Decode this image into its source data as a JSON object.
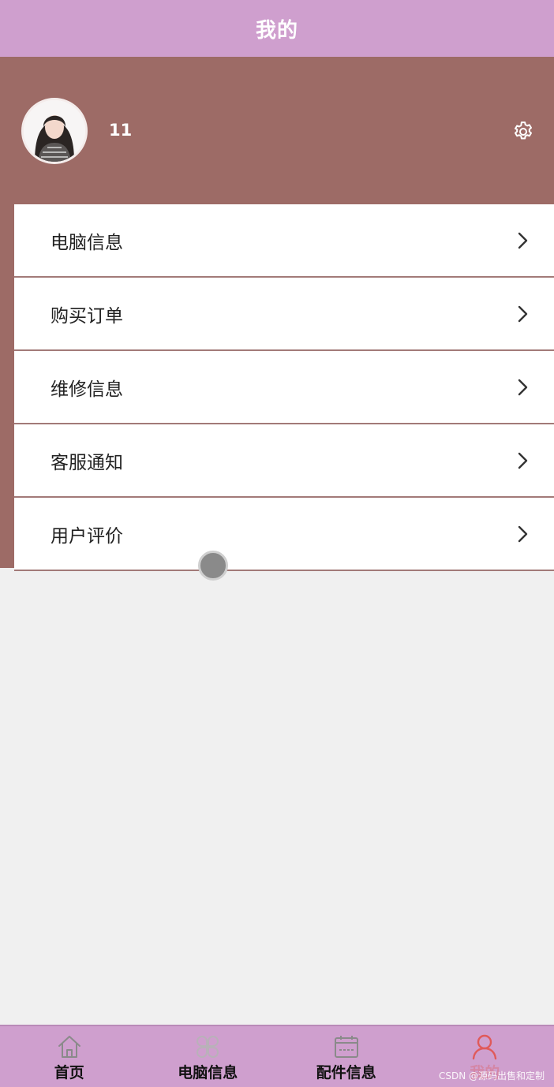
{
  "header": {
    "title": "我的"
  },
  "profile": {
    "username": "11",
    "avatar_icon": "user-photo-avatar",
    "settings_icon": "gear-icon"
  },
  "menu": {
    "items": [
      {
        "label": "电脑信息",
        "icon": "chevron-right-icon"
      },
      {
        "label": "购买订单",
        "icon": "chevron-right-icon"
      },
      {
        "label": "维修信息",
        "icon": "chevron-right-icon"
      },
      {
        "label": "客服通知",
        "icon": "chevron-right-icon"
      },
      {
        "label": "用户评价",
        "icon": "chevron-right-icon"
      }
    ]
  },
  "tabbar": {
    "tabs": [
      {
        "label": "首页",
        "icon": "home-icon",
        "active": false
      },
      {
        "label": "电脑信息",
        "icon": "clover-icon",
        "active": false
      },
      {
        "label": "配件信息",
        "icon": "calendar-icon",
        "active": false
      },
      {
        "label": "我的",
        "icon": "user-icon",
        "active": true
      }
    ]
  },
  "watermark": "CSDN @源码出售和定制",
  "colors": {
    "header_bg": "#cf9fce",
    "profile_bg": "#9d6b66",
    "page_bg": "#f0f0f0",
    "active_tab": "#e05a5a",
    "divider": "#a27a78"
  }
}
